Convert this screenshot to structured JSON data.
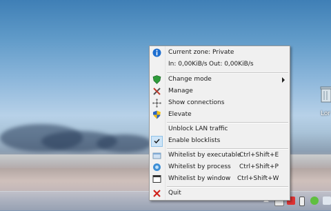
{
  "menu": {
    "zone": "Current zone: Private",
    "traffic_in": "In: 0,00KiB/s",
    "traffic_out": "Out: 0,00KiB/s",
    "change_mode": "Change mode",
    "manage": "Manage",
    "show_connections": "Show connections",
    "elevate": "Elevate",
    "unblock_lan": "Unblock LAN traffic",
    "enable_blocklists": "Enable blocklists",
    "enable_blocklists_checked": true,
    "whitelist_exe": "Whitelist by executable",
    "whitelist_exe_shortcut": "Ctrl+Shift+E",
    "whitelist_proc": "Whitelist by process",
    "whitelist_proc_shortcut": "Ctrl+Shift+P",
    "whitelist_win": "Whitelist by window",
    "whitelist_win_shortcut": "Ctrl+Shift+W",
    "quit": "Quit"
  },
  "desktop": {
    "icon_label": "Lor"
  },
  "icons": {
    "info": "info-icon",
    "mode": "shield-icon",
    "manage": "tools-icon",
    "connections": "network-icon",
    "elevate": "uac-shield-icon",
    "check": "checkmark-icon",
    "exe": "executable-icon",
    "process": "process-icon",
    "window": "window-icon",
    "quit": "quit-x-icon"
  },
  "colors": {
    "menu_bg": "#f0f0f0",
    "check_bg": "#cde4f7",
    "quit_red": "#d0201a",
    "info_blue": "#1e6fd0"
  }
}
